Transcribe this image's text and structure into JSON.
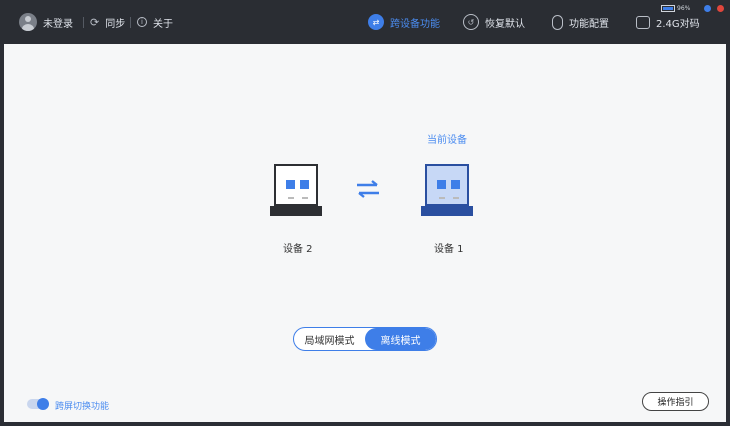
{
  "topbar": {
    "user_label": "未登录",
    "sync_label": "同步",
    "about_label": "关于",
    "nav": [
      {
        "label": "跨设备功能",
        "icon": "cross-device-icon",
        "active": true
      },
      {
        "label": "恢复默认",
        "icon": "restore-icon",
        "active": false
      },
      {
        "label": "功能配置",
        "icon": "mouse-icon",
        "active": false
      },
      {
        "label": "2.4G对码",
        "icon": "receiver-icon",
        "active": false
      }
    ],
    "battery_percent": "96%",
    "battery_level": 0.96,
    "colors": {
      "accent": "#3e7ee8",
      "close": "#e0463c"
    }
  },
  "main": {
    "current_device_label": "当前设备",
    "devices": [
      {
        "label": "设备 2",
        "current": false
      },
      {
        "label": "设备 1",
        "current": true
      }
    ],
    "switch_icon": "swap-arrows-icon",
    "modes": [
      {
        "label": "局域网模式",
        "selected": false
      },
      {
        "label": "离线模式",
        "selected": true
      }
    ]
  },
  "footer": {
    "toggle_label": "跨屏切换功能",
    "toggle_on": true,
    "guide_label": "操作指引"
  }
}
